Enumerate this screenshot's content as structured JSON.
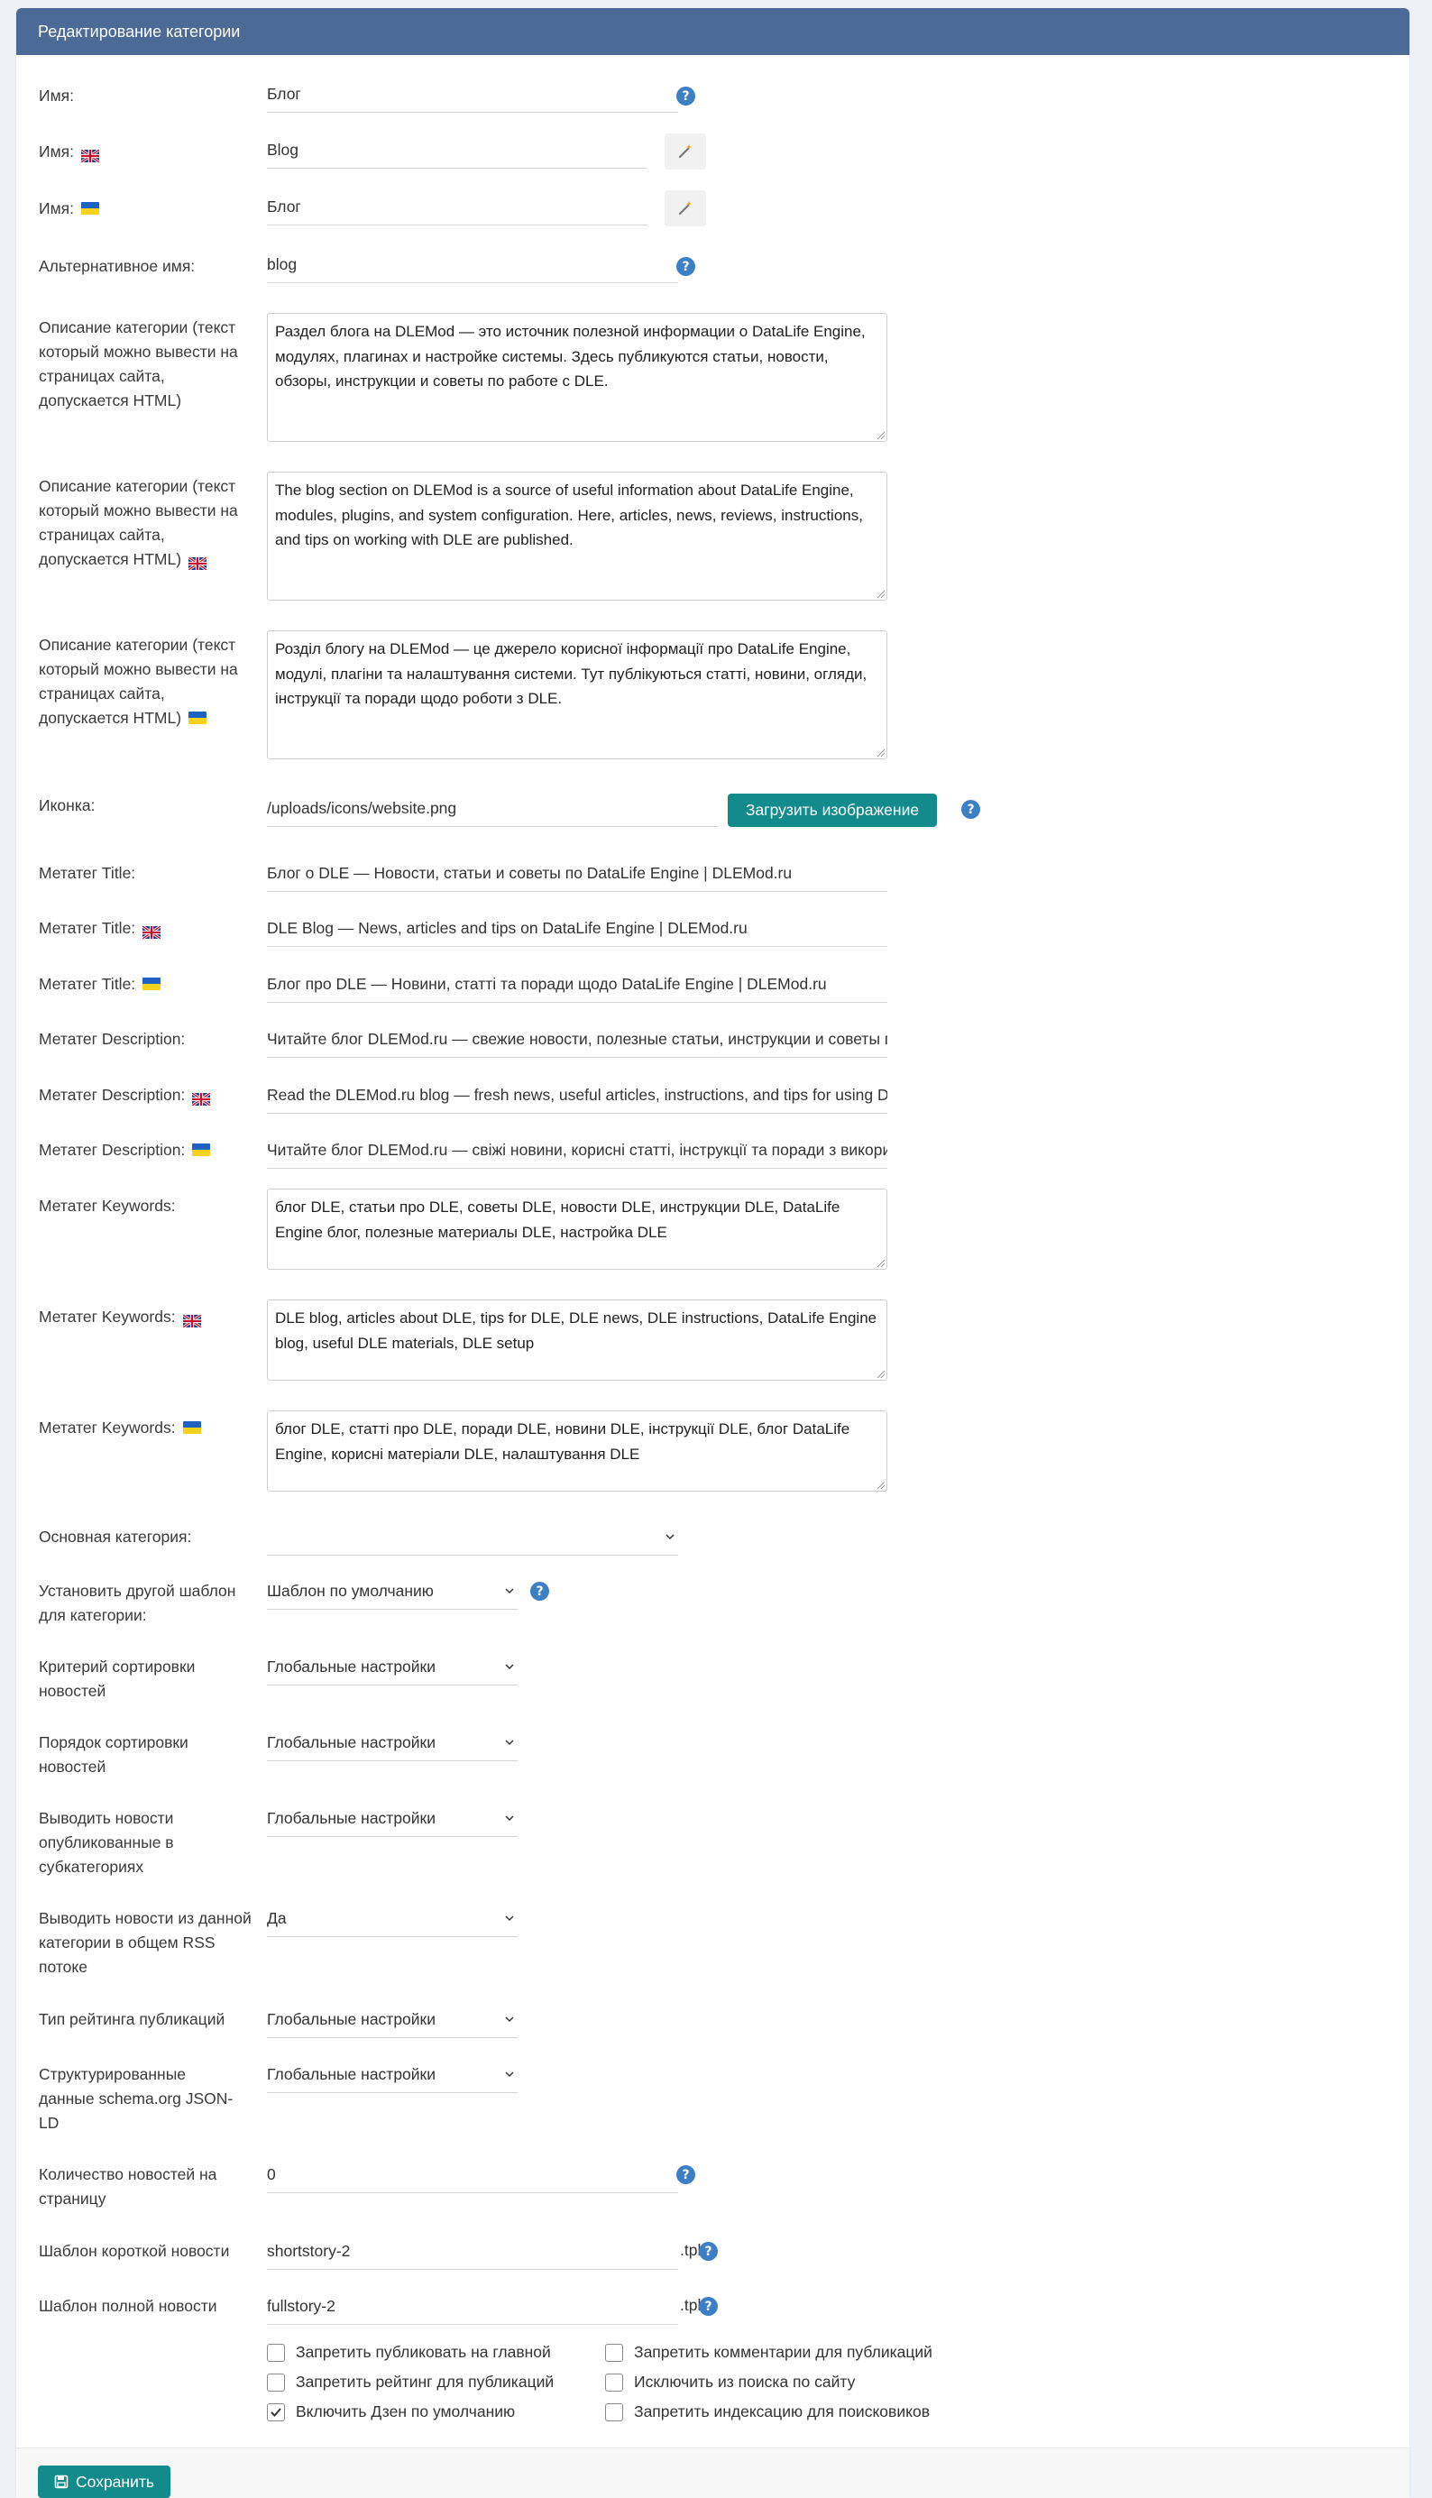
{
  "header": {
    "title": "Редактирование категории"
  },
  "fields": {
    "name": {
      "label": "Имя:",
      "value": "Блог"
    },
    "name_en": {
      "label": "Имя:",
      "value": "Blog"
    },
    "name_ua": {
      "label": "Имя:",
      "value": "Блог"
    },
    "alt_name": {
      "label": "Альтернативное имя:",
      "value": "blog"
    },
    "desc": {
      "label": "Описание категории (текст который можно вывести на страницах сайта, допускается HTML)",
      "value": "Раздел блога на DLEMod — это источник полезной информации о DataLife Engine, модулях, плагинах и настройке системы. Здесь публикуются статьи, новости, обзоры, инструкции и советы по работе с DLE."
    },
    "desc_en": {
      "label": "Описание категории (текст который можно вывести на страницах сайта, допускается HTML)",
      "value": "The blog section on DLEMod is a source of useful information about DataLife Engine, modules, plugins, and system configuration. Here, articles, news, reviews, instructions, and tips on working with DLE are published."
    },
    "desc_ua": {
      "label": "Описание категории (текст который можно вывести на страницах сайта, допускается HTML)",
      "value": "Розділ блогу на DLEMod — це джерело корисної інформації про DataLife Engine, модулі, плагіни та налаштування системи. Тут публікуються статті, новини, огляди, інструкції та поради щодо роботи з DLE."
    },
    "icon": {
      "label": "Иконка:",
      "value": "/uploads/icons/website.png",
      "button": "Загрузить изображение"
    },
    "meta_title": {
      "label": "Метатег Title:",
      "value": "Блог о DLE — Новости, статьи и советы по DataLife Engine | DLEMod.ru"
    },
    "meta_title_en": {
      "label": "Метатег Title:",
      "value": "DLE Blog — News, articles and tips on DataLife Engine | DLEMod.ru"
    },
    "meta_title_ua": {
      "label": "Метатег Title:",
      "value": "Блог про DLE — Новини, статті та поради щодо DataLife Engine | DLEMod.ru"
    },
    "meta_desc": {
      "label": "Метатег Description:",
      "value": "Читайте блог DLEMod.ru — свежие новости, полезные статьи, инструкции и советы по DataLife Engine"
    },
    "meta_desc_en": {
      "label": "Метатег Description:",
      "value": "Read the DLEMod.ru blog — fresh news, useful articles, instructions, and tips for using DataLife Engine"
    },
    "meta_desc_ua": {
      "label": "Метатег Description:",
      "value": "Читайте блог DLEMod.ru — свіжі новини, корисні статті, інструкції та поради з використання DataLife Engine"
    },
    "meta_kw": {
      "label": "Метатег Keywords:",
      "value": "блог DLE, статьи про DLE, советы DLE, новости DLE, инструкции DLE, DataLife Engine блог, полезные материалы DLE, настройка DLE"
    },
    "meta_kw_en": {
      "label": "Метатег Keywords:",
      "value": "DLE blog, articles about DLE, tips for DLE, DLE news, DLE instructions, DataLife Engine blog, useful DLE materials, DLE setup"
    },
    "meta_kw_ua": {
      "label": "Метатег Keywords:",
      "value": "блог DLE, статті про DLE, поради DLE, новини DLE, інструкції DLE, блог DataLife Engine, корисні матеріали DLE, налаштування DLE"
    },
    "parent": {
      "label": "Основная категория:",
      "value": ""
    },
    "skin": {
      "label": "Установить другой шаблон для категории:",
      "value": "Шаблон по умолчанию"
    },
    "sort_criteria": {
      "label": "Критерий сортировки новостей",
      "value": "Глобальные настройки"
    },
    "sort_order": {
      "label": "Порядок сортировки новостей",
      "value": "Глобальные настройки"
    },
    "show_sub": {
      "label": "Выводить новости опубликованные в субкатегориях",
      "value": "Глобальные настройки"
    },
    "rss": {
      "label": "Выводить новости из данной категории в общем RSS потоке",
      "value": "Да"
    },
    "rating_type": {
      "label": "Тип рейтинга публикаций",
      "value": "Глобальные настройки"
    },
    "schema": {
      "label": "Структурированные данные schema.org JSON-LD",
      "value": "Глобальные настройки"
    },
    "news_per_page": {
      "label": "Количество новостей на страницу",
      "value": "0"
    },
    "short_tpl": {
      "label": "Шаблон короткой новости",
      "value": "shortstory-2",
      "suffix": ".tpl"
    },
    "full_tpl": {
      "label": "Шаблон полной новости",
      "value": "fullstory-2",
      "suffix": ".tpl"
    }
  },
  "checkboxes": [
    {
      "label": "Запретить публиковать на главной",
      "checked": false
    },
    {
      "label": "Запретить комментарии для публикаций",
      "checked": false
    },
    {
      "label": "Запретить рейтинг для публикаций",
      "checked": false
    },
    {
      "label": "Исключить из поиска по сайту",
      "checked": false
    },
    {
      "label": "Включить Дзен по умолчанию",
      "checked": true
    },
    {
      "label": "Запретить индексацию для поисковиков",
      "checked": false
    }
  ],
  "footer": {
    "save_label": "Сохранить"
  },
  "colors": {
    "header": "#4b6a96",
    "button": "#138a8c",
    "help": "#3c7fc4"
  }
}
